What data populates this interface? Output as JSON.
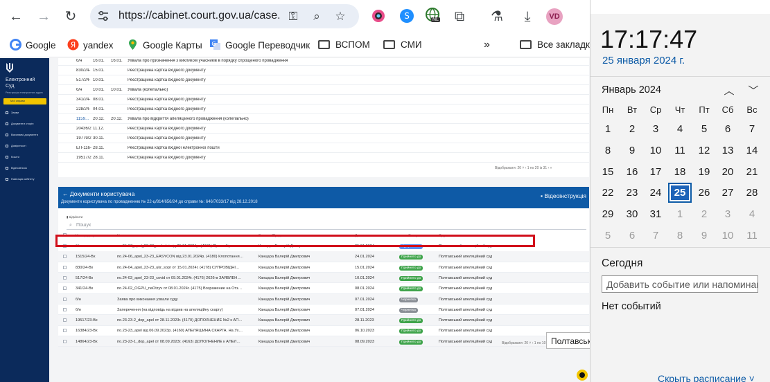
{
  "browser": {
    "url": "https://cabinet.court.gov.ua/case...",
    "avatar_initials": "VD",
    "ext_badge": "NL"
  },
  "bookmarks": [
    {
      "label": "Google"
    },
    {
      "label": "yandex"
    },
    {
      "label": "Google Карты"
    },
    {
      "label": "Google Переводчик"
    },
    {
      "label": "ВСПОМ"
    },
    {
      "label": "СМИ"
    },
    {
      "label": "Все закладки"
    }
  ],
  "sidebar": {
    "title": "Електронний Суд",
    "subtitle": "Реєстрація електронних адрес",
    "active": "Мої справи",
    "items": [
      "Заяви",
      "Документи сторін",
      "Виконавчі документи",
      "Довіреності",
      "Кошти",
      "Відеозв'язок",
      "Навігація кабінету"
    ]
  },
  "upper_rows": [
    {
      "num": "б/н",
      "date1": "16.01.",
      "date2": "16.01.",
      "text": "Ухвала про призначення з викликом учасників в порядку спрощеного провадження",
      "link": false
    },
    {
      "num": "830/24-",
      "date1": "15.01.",
      "date2": "",
      "text": "Реєстраційна картка вхідного документу",
      "link": false
    },
    {
      "num": "517/24-",
      "date1": "10.01.",
      "date2": "",
      "text": "Реєстраційна картка вхідного документу",
      "link": false
    },
    {
      "num": "б/н",
      "date1": "10.01.",
      "date2": "10.01.",
      "text": "Ухвала (колегіально)",
      "link": false
    },
    {
      "num": "341/24-",
      "date1": "08.01.",
      "date2": "",
      "text": "Реєстраційна картка вхідного документу",
      "link": false
    },
    {
      "num": "228/24-",
      "date1": "04.01.",
      "date2": "",
      "text": "Реєстраційна картка вхідного документу",
      "link": false
    },
    {
      "num": "1159…",
      "date1": "20.12.",
      "date2": "20.12.",
      "text": "Ухвала про відкриття апеляційного провадження (колегіально)",
      "link": true
    },
    {
      "num": "20436/2",
      "date1": "11.12.",
      "date2": "",
      "text": "Реєстраційна картка вхідного документу",
      "link": false
    },
    {
      "num": "19779/2",
      "date1": "30.11.",
      "date2": "",
      "text": "Реєстраційна картка вхідного документу",
      "link": false
    },
    {
      "num": "ЕП-116-",
      "date1": "28.11.",
      "date2": "",
      "text": "Реєстраційна картка вхідної електронної пошти",
      "link": false
    },
    {
      "num": "19517/2",
      "date1": "28.11.",
      "date2": "",
      "text": "Реєстраційна картка вхідного документу",
      "link": false
    }
  ],
  "upper_pager": "Відображати: 20 ˅   ‹   1 по 20 із 31   ›   »",
  "panel": {
    "title": "← Документи користувача",
    "subtitle": "Документи користувача по провадженню № 22-ц/814/656/24 до справи №: 646/7033/17 від 28.12.2018",
    "video": "Відеоінструкція",
    "filter": "відмінити",
    "search_placeholder": "Пошук",
    "columns": [
      "Номер документа",
      "Назва",
      "Заявник/Представник",
      "Дата",
      "Статус",
      "Суд"
    ],
    "rows": [
      {
        "num": "б/н",
        "name": "по.24-07_apel_23-23_makulat від 25.01.2024р. (4181) Про вибірне п…",
        "applicant": "Канцара Валерій Дмитрович",
        "date": "25.01.2024",
        "status": "Відправлено",
        "status_color": "#5b8def",
        "court": "Полтавський апеляційний суд"
      },
      {
        "num": "1515/24-Вх",
        "name": "по.24-06_apel_23-23_EASYCON від 23.01.2024р. (4180) Клопотання…",
        "applicant": "Канцара Валерій Дмитрович",
        "date": "24.01.2024",
        "status": "Прийнято до",
        "status_color": "#3fa44b",
        "court": "Полтавський апеляційний суд"
      },
      {
        "num": "830/24-Вх",
        "name": "по.24-04_apel_23-23_ukr_sopr от 15.01.2024г. (4178) СУПРОВІДНІ…",
        "applicant": "Канцара Валерій Дмитрович",
        "date": "15.01.2024",
        "status": "Прийнято до",
        "status_color": "#3fa44b",
        "court": "Полтавський апеляційний суд"
      },
      {
        "num": "517/24-Вх",
        "name": "по.24-03_apel_23-23_covid от 09.01.2024г. (4176) 2626-в ЗАЯВЛЕН…",
        "applicant": "Канцара Валерій Дмитрович",
        "date": "10.01.2024",
        "status": "Прийнято до",
        "status_color": "#3fa44b",
        "court": "Полтавський апеляційний суд"
      },
      {
        "num": "341/24-Вх",
        "name": "по.24-02_OGPU_naOtzyv от 08.01.2024г. (4175) Возражение на Отз…",
        "applicant": "Канцара Валерій Дмитрович",
        "date": "08.01.2024",
        "status": "Прийнято до",
        "status_color": "#3fa44b",
        "court": "Полтавський апеляційний суд"
      },
      {
        "num": "б/н",
        "name": "Заява про виконання ухвали суду",
        "applicant": "Канцара Валерій Дмитрович",
        "date": "07.01.2024",
        "status": "Чернетка",
        "status_color": "#8a8f96",
        "court": "Полтавський апеляційний суд"
      },
      {
        "num": "б/н",
        "name": "Заперечення (на відповідь на відзив на апеляційну скаргу)",
        "applicant": "Канцара Валерій Дмитрович",
        "date": "07.01.2024",
        "status": "Чернетка",
        "status_color": "#8a8f96",
        "court": "Полтавський апеляційний суд"
      },
      {
        "num": "19517/23-Вх",
        "name": "по.23-23-2_dop_apel от 28.11.2023г. (4170) ДОПОЛНЕНИЕ №2 к АП…",
        "applicant": "Канцара Валерій Дмитрович",
        "date": "28.11.2023",
        "status": "Прийнято до",
        "status_color": "#3fa44b",
        "court": "Полтавський апеляційний суд"
      },
      {
        "num": "16384/23-Вх",
        "name": "по.23-23_apel від 06.09.2023р. (4160) АПЕЛЯЦІЙНА СКАРГА. На Ух…",
        "applicant": "Канцара Валерій Дмитрович",
        "date": "06.10.2023",
        "status": "Прийнято до",
        "status_color": "#3fa44b",
        "court": "Полтавський апеляційний суд"
      },
      {
        "num": "14864/23-Вх",
        "name": "по.23-23-1_dop_apel от 08.09.2023г. (4163) ДОПОЛНЕНИЕ к АПЕЛ…",
        "applicant": "Канцара Валерій Дмитрович",
        "date": "08.09.2023",
        "status": "Прийнято до",
        "status_color": "#3fa44b",
        "court": "Полтавський апеляційний суд"
      }
    ],
    "pager": "Відображати: 20 ˅   ‹   1 по 10 із 10   ›"
  },
  "tooltip": "Полтавськ",
  "calendar": {
    "time": "17:17:47",
    "date": "25 января 2024 г.",
    "month": "Январь 2024",
    "weekdays": [
      "Пн",
      "Вт",
      "Ср",
      "Чт",
      "Пт",
      "Сб",
      "Вс"
    ],
    "weeks": [
      [
        "1",
        "2",
        "3",
        "4",
        "5",
        "6",
        "7"
      ],
      [
        "8",
        "9",
        "10",
        "11",
        "12",
        "13",
        "14"
      ],
      [
        "15",
        "16",
        "17",
        "18",
        "19",
        "20",
        "21"
      ],
      [
        "22",
        "23",
        "24",
        "25",
        "26",
        "27",
        "28"
      ],
      [
        "29",
        "30",
        "31",
        "1",
        "2",
        "3",
        "4"
      ],
      [
        "5",
        "6",
        "7",
        "8",
        "9",
        "10",
        "11"
      ]
    ],
    "today": "25",
    "today_label": "Сегодня",
    "event_placeholder": "Добавить событие или напоминание",
    "no_events": "Нет событий",
    "hide_schedule": "Скрыть расписание ˅"
  }
}
